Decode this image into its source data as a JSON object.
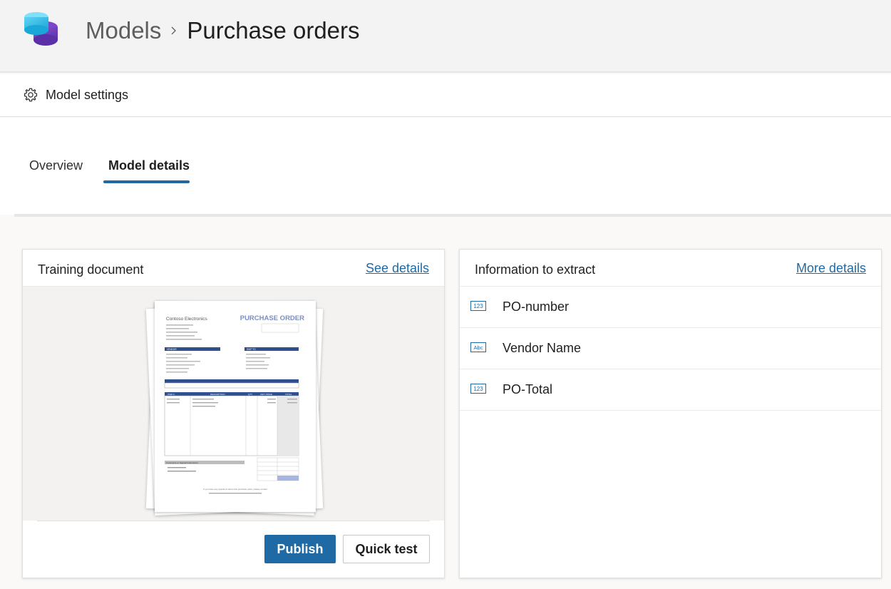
{
  "header": {
    "breadcrumb_root": "Models",
    "breadcrumb_current": "Purchase orders"
  },
  "settings": {
    "label": "Model settings"
  },
  "tabs": [
    {
      "label": "Overview",
      "selected": false
    },
    {
      "label": "Model details",
      "selected": true
    }
  ],
  "training_card": {
    "title": "Training document",
    "link": "See details",
    "publish_label": "Publish",
    "quick_test_label": "Quick test",
    "document": {
      "company": "Contoso Electronics",
      "heading": "PURCHASE ORDER",
      "section_vendor": "VENDOR",
      "section_ship_to": "SHIP TO",
      "table_headers": [
        "ITEM #",
        "DESCRIPTION",
        "QTY",
        "UNIT PRICE",
        "TOTAL"
      ],
      "comments_header": "Comments or Special Instructions",
      "footer_line": "If you have any questions about this purchase order, please contact"
    }
  },
  "extract_card": {
    "title": "Information to extract",
    "link": "More details",
    "fields": [
      {
        "label": "PO-number",
        "icon": "number-field-icon",
        "icon_text": "123"
      },
      {
        "label": "Vendor Name",
        "icon": "text-field-icon",
        "icon_text": "Abc"
      },
      {
        "label": "PO-Total",
        "icon": "number-field-icon",
        "icon_text": "123"
      }
    ]
  },
  "colors": {
    "accent": "#1f6aa5",
    "doc_heading": "#7b8ec4",
    "doc_bar": "#2f4f8f"
  }
}
